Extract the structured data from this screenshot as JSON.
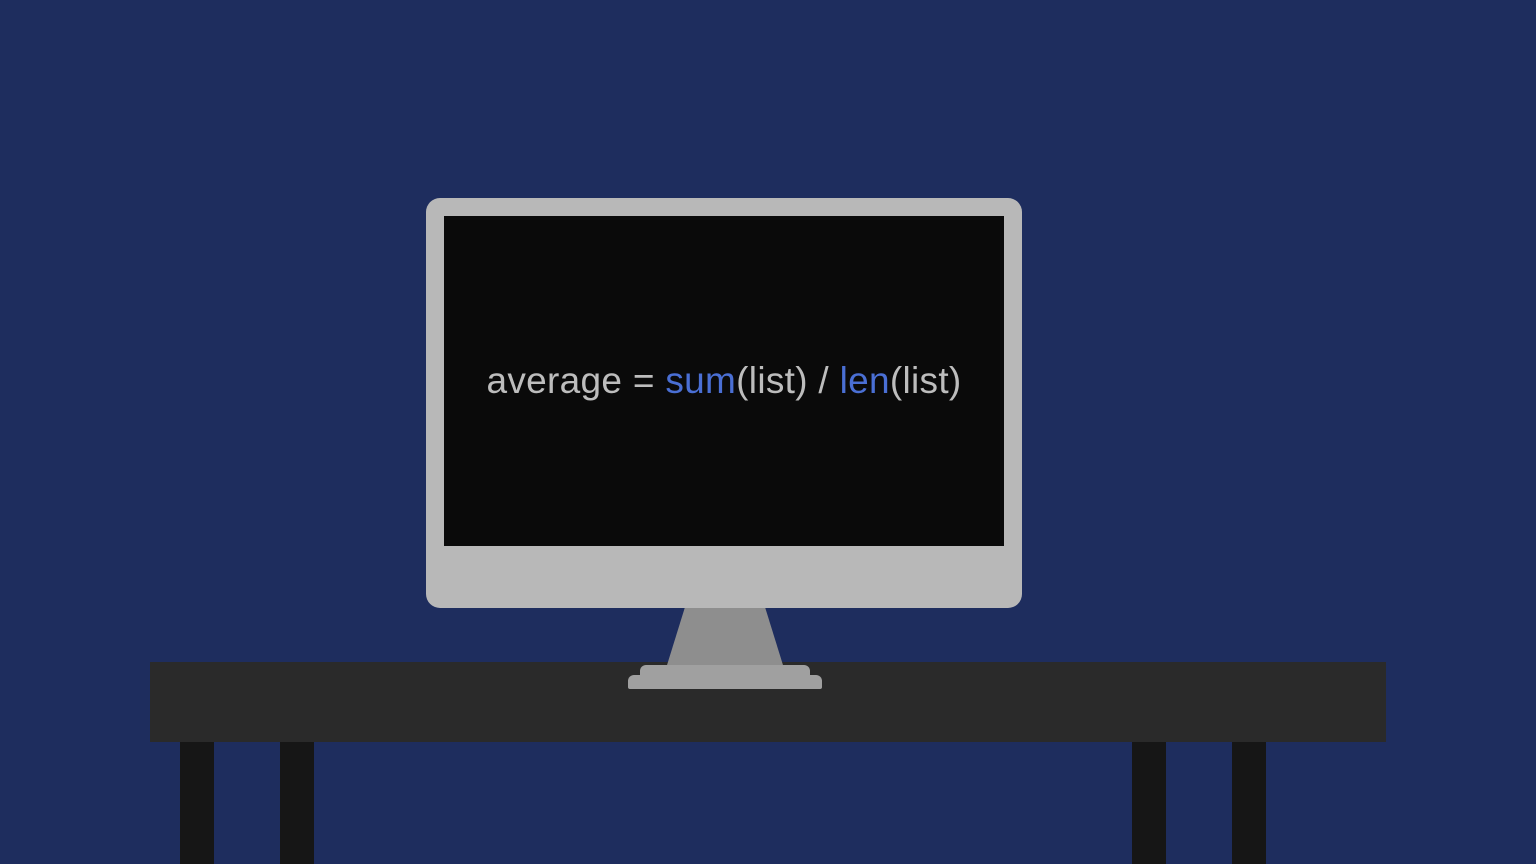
{
  "code": {
    "t1": "average = ",
    "fn1": "sum",
    "t2": "(list) / ",
    "fn2": "len",
    "t3": "(list)"
  }
}
